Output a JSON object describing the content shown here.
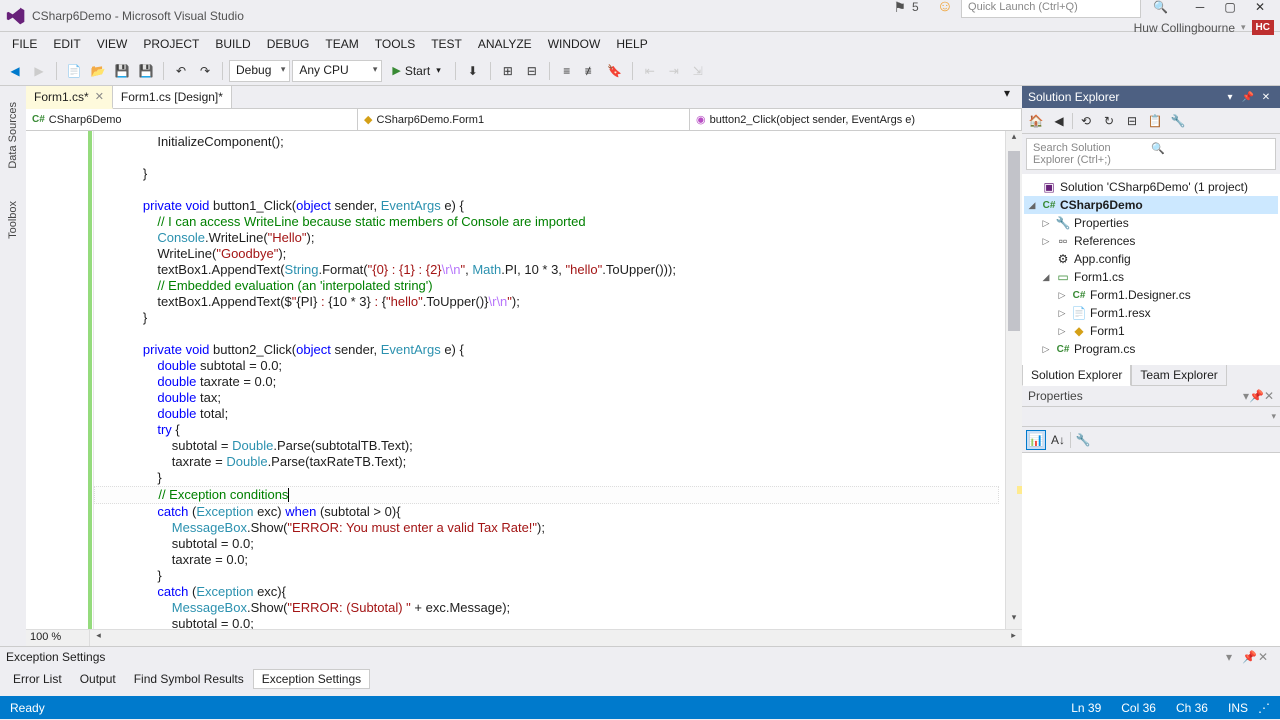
{
  "window": {
    "title": "CSharp6Demo - Microsoft Visual Studio",
    "notification_count": "5",
    "quick_launch_placeholder": "Quick Launch (Ctrl+Q)",
    "user_name": "Huw Collingbourne",
    "user_initials": "HC"
  },
  "menu": {
    "items": [
      "FILE",
      "EDIT",
      "VIEW",
      "PROJECT",
      "BUILD",
      "DEBUG",
      "TEAM",
      "TOOLS",
      "TEST",
      "ANALYZE",
      "WINDOW",
      "HELP"
    ]
  },
  "toolbar": {
    "config": "Debug",
    "platform": "Any CPU",
    "start": "Start"
  },
  "left_tabs": [
    "Data Sources",
    "Toolbox"
  ],
  "editor": {
    "tabs": [
      {
        "label": "Form1.cs*",
        "active": true
      },
      {
        "label": "Form1.cs [Design]*",
        "active": false
      }
    ],
    "nav": {
      "project": "CSharp6Demo",
      "class": "CSharp6Demo.Form1",
      "member": "button2_Click(object sender, EventArgs e)"
    },
    "zoom": "100 %"
  },
  "code": {
    "lines": [
      {
        "indent": 12,
        "tokens": [
          {
            "t": "InitializeComponent();"
          }
        ]
      },
      {
        "indent": 0,
        "tokens": []
      },
      {
        "indent": 8,
        "tokens": [
          {
            "t": "}"
          }
        ]
      },
      {
        "indent": 0,
        "tokens": []
      },
      {
        "indent": 8,
        "tokens": [
          {
            "t": "private",
            "c": "kw"
          },
          {
            "t": " "
          },
          {
            "t": "void",
            "c": "kw"
          },
          {
            "t": " button1_Click("
          },
          {
            "t": "object",
            "c": "kw"
          },
          {
            "t": " sender, "
          },
          {
            "t": "EventArgs",
            "c": "type"
          },
          {
            "t": " e) {"
          }
        ]
      },
      {
        "indent": 12,
        "tokens": [
          {
            "t": "// I can access WriteLine because static members of Console are imported",
            "c": "cmt"
          }
        ]
      },
      {
        "indent": 12,
        "tokens": [
          {
            "t": "Console",
            "c": "type"
          },
          {
            "t": ".WriteLine("
          },
          {
            "t": "\"Hello\"",
            "c": "str"
          },
          {
            "t": ");"
          }
        ]
      },
      {
        "indent": 12,
        "tokens": [
          {
            "t": "WriteLine("
          },
          {
            "t": "\"Goodbye\"",
            "c": "str"
          },
          {
            "t": ");"
          }
        ]
      },
      {
        "indent": 12,
        "tokens": [
          {
            "t": "textBox1.AppendText("
          },
          {
            "t": "String",
            "c": "type"
          },
          {
            "t": ".Format("
          },
          {
            "t": "\"{0} : {1} : {2}",
            "c": "str"
          },
          {
            "t": "\\r\\n",
            "c": "esc"
          },
          {
            "t": "\"",
            "c": "str"
          },
          {
            "t": ", "
          },
          {
            "t": "Math",
            "c": "type"
          },
          {
            "t": ".PI, 10 * 3, "
          },
          {
            "t": "\"hello\"",
            "c": "str"
          },
          {
            "t": ".ToUpper()));"
          }
        ]
      },
      {
        "indent": 12,
        "tokens": [
          {
            "t": "// Embedded evaluation (an 'interpolated string')",
            "c": "cmt"
          }
        ]
      },
      {
        "indent": 12,
        "tokens": [
          {
            "t": "textBox1.AppendText($"
          },
          {
            "t": "\"",
            "c": "str"
          },
          {
            "t": "{PI}"
          },
          {
            "t": " : ",
            "c": "str"
          },
          {
            "t": "{10 * 3}"
          },
          {
            "t": " : ",
            "c": "str"
          },
          {
            "t": "{"
          },
          {
            "t": "\"hello\"",
            "c": "str"
          },
          {
            "t": ".ToUpper()}"
          },
          {
            "t": "\\r\\n",
            "c": "esc"
          },
          {
            "t": "\"",
            "c": "str"
          },
          {
            "t": ");"
          }
        ]
      },
      {
        "indent": 8,
        "tokens": [
          {
            "t": "}"
          }
        ]
      },
      {
        "indent": 0,
        "tokens": []
      },
      {
        "indent": 8,
        "tokens": [
          {
            "t": "private",
            "c": "kw"
          },
          {
            "t": " "
          },
          {
            "t": "void",
            "c": "kw"
          },
          {
            "t": " button2_Click("
          },
          {
            "t": "object",
            "c": "kw"
          },
          {
            "t": " sender, "
          },
          {
            "t": "EventArgs",
            "c": "type"
          },
          {
            "t": " e) {"
          }
        ]
      },
      {
        "indent": 12,
        "tokens": [
          {
            "t": "double",
            "c": "kw"
          },
          {
            "t": " subtotal = 0.0;"
          }
        ]
      },
      {
        "indent": 12,
        "tokens": [
          {
            "t": "double",
            "c": "kw"
          },
          {
            "t": " taxrate = 0.0;"
          }
        ]
      },
      {
        "indent": 12,
        "tokens": [
          {
            "t": "double",
            "c": "kw"
          },
          {
            "t": " tax;"
          }
        ]
      },
      {
        "indent": 12,
        "tokens": [
          {
            "t": "double",
            "c": "kw"
          },
          {
            "t": " total;"
          }
        ]
      },
      {
        "indent": 12,
        "tokens": [
          {
            "t": "try",
            "c": "kw"
          },
          {
            "t": " {"
          }
        ]
      },
      {
        "indent": 16,
        "tokens": [
          {
            "t": "subtotal = "
          },
          {
            "t": "Double",
            "c": "type"
          },
          {
            "t": ".Parse(subtotalTB.Text);"
          }
        ]
      },
      {
        "indent": 16,
        "tokens": [
          {
            "t": "taxrate = "
          },
          {
            "t": "Double",
            "c": "type"
          },
          {
            "t": ".Parse(taxRateTB.Text);"
          }
        ]
      },
      {
        "indent": 12,
        "tokens": [
          {
            "t": "}"
          }
        ]
      },
      {
        "indent": 12,
        "cursor": true,
        "tokens": [
          {
            "t": "// Exception conditions",
            "c": "cmt"
          }
        ]
      },
      {
        "indent": 12,
        "tokens": [
          {
            "t": "catch",
            "c": "kw"
          },
          {
            "t": " ("
          },
          {
            "t": "Exception",
            "c": "type"
          },
          {
            "t": " exc) "
          },
          {
            "t": "when",
            "c": "kw"
          },
          {
            "t": " (subtotal > 0){"
          }
        ]
      },
      {
        "indent": 16,
        "tokens": [
          {
            "t": "MessageBox",
            "c": "type"
          },
          {
            "t": ".Show("
          },
          {
            "t": "\"ERROR: You must enter a valid Tax Rate!\"",
            "c": "str"
          },
          {
            "t": ");"
          }
        ]
      },
      {
        "indent": 16,
        "tokens": [
          {
            "t": "subtotal = 0.0;"
          }
        ]
      },
      {
        "indent": 16,
        "tokens": [
          {
            "t": "taxrate = 0.0;"
          }
        ]
      },
      {
        "indent": 12,
        "tokens": [
          {
            "t": "}"
          }
        ]
      },
      {
        "indent": 12,
        "tokens": [
          {
            "t": "catch",
            "c": "kw"
          },
          {
            "t": " ("
          },
          {
            "t": "Exception",
            "c": "type"
          },
          {
            "t": " exc){"
          }
        ]
      },
      {
        "indent": 16,
        "tokens": [
          {
            "t": "MessageBox",
            "c": "type"
          },
          {
            "t": ".Show("
          },
          {
            "t": "\"ERROR: (Subtotal) \"",
            "c": "str"
          },
          {
            "t": " + exc.Message);"
          }
        ]
      },
      {
        "indent": 16,
        "tokens": [
          {
            "t": "subtotal = 0.0;"
          }
        ]
      }
    ]
  },
  "solution_explorer": {
    "title": "Solution Explorer",
    "search_placeholder": "Search Solution Explorer (Ctrl+;)",
    "tree": [
      {
        "label": "Solution 'CSharp6Demo' (1 project)",
        "icon": "solution",
        "indent": 0,
        "exp": "none"
      },
      {
        "label": "CSharp6Demo",
        "icon": "csproj",
        "indent": 0,
        "exp": "open",
        "bold": true,
        "selected": true
      },
      {
        "label": "Properties",
        "icon": "wrench",
        "indent": 1,
        "exp": "closed"
      },
      {
        "label": "References",
        "icon": "refs",
        "indent": 1,
        "exp": "closed"
      },
      {
        "label": "App.config",
        "icon": "config",
        "indent": 1,
        "exp": "none"
      },
      {
        "label": "Form1.cs",
        "icon": "form",
        "indent": 1,
        "exp": "open"
      },
      {
        "label": "Form1.Designer.cs",
        "icon": "cs",
        "indent": 2,
        "exp": "closed"
      },
      {
        "label": "Form1.resx",
        "icon": "resx",
        "indent": 2,
        "exp": "closed"
      },
      {
        "label": "Form1",
        "icon": "class",
        "indent": 2,
        "exp": "closed"
      },
      {
        "label": "Program.cs",
        "icon": "cs",
        "indent": 1,
        "exp": "closed"
      }
    ],
    "tabs": [
      "Solution Explorer",
      "Team Explorer"
    ]
  },
  "properties": {
    "title": "Properties"
  },
  "bottom_dock": {
    "title": "Exception Settings",
    "tabs": [
      "Error List",
      "Output",
      "Find Symbol Results",
      "Exception Settings"
    ]
  },
  "status": {
    "ready": "Ready",
    "line": "Ln 39",
    "col": "Col 36",
    "ch": "Ch 36",
    "ins": "INS"
  }
}
